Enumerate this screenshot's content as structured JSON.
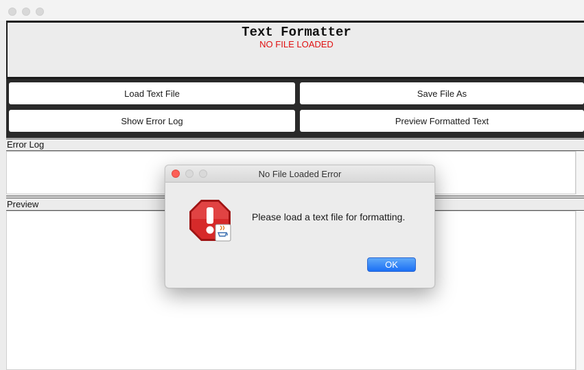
{
  "app": {
    "title": "Text Formatter",
    "file_status": "NO FILE LOADED",
    "status_color": "#e01010"
  },
  "toolbar": {
    "load_label": "Load Text File",
    "save_label": "Save File As",
    "error_log_label": "Show  Error Log",
    "preview_label": "Preview Formatted Text"
  },
  "sections": {
    "error_log_label": "Error Log",
    "preview_label": "Preview"
  },
  "dialog": {
    "title": "No File Loaded Error",
    "message": "Please load a text file for formatting.",
    "ok_label": "OK",
    "icon": "error-stop-icon"
  },
  "colors": {
    "accent_button": "#1b6ff5",
    "error_icon": "#d62a2a"
  }
}
